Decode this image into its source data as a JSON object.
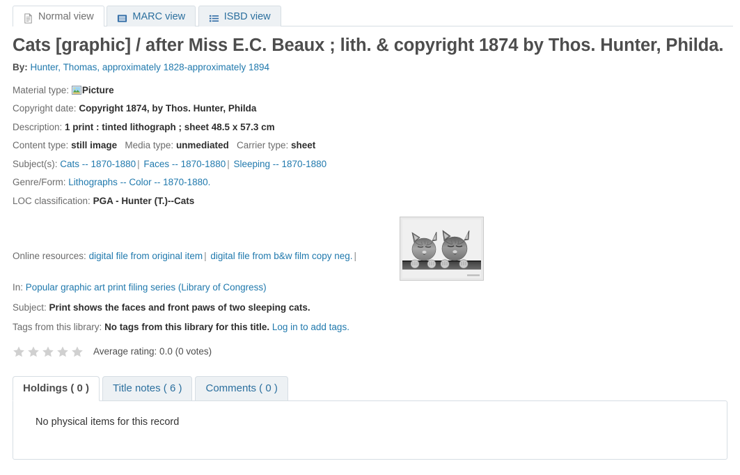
{
  "view_tabs": [
    {
      "label": "Normal view",
      "icon": "document-icon",
      "active": true
    },
    {
      "label": "MARC view",
      "icon": "table-list-icon",
      "active": false
    },
    {
      "label": "ISBD view",
      "icon": "list-icon",
      "active": false
    }
  ],
  "record": {
    "title": "Cats [graphic] / after Miss E.C. Beaux ; lith. & copyright 1874 by Thos. Hunter, Philda.",
    "by_label": "By:",
    "author": "Hunter, Thomas, approximately 1828-approximately 1894",
    "material_type_label": "Material type:",
    "material_type_value": "Picture",
    "material_type_icon": "picture-icon",
    "copyright_date_label": "Copyright date:",
    "copyright_date_value": "Copyright 1874, by Thos. Hunter, Philda",
    "description_label": "Description:",
    "description_value": "1 print : tinted lithograph ; sheet 48.5 x 57.3 cm",
    "content_type_label": "Content type:",
    "content_type_value": "still image",
    "media_type_label": "Media type:",
    "media_type_value": "unmediated",
    "carrier_type_label": "Carrier type:",
    "carrier_type_value": "sheet",
    "subjects_label": "Subject(s):",
    "subjects": [
      "Cats -- 1870-1880",
      "Faces -- 1870-1880",
      "Sleeping -- 1870-1880"
    ],
    "subject_separator": "|",
    "genre_label": "Genre/Form:",
    "genre_value": "Lithographs -- Color -- 1870-1880.",
    "loc_label": "LOC classification:",
    "loc_value": "PGA - Hunter (T.)--Cats",
    "online_resources_label": "Online resources:",
    "online_resources": [
      "digital file from original item",
      "digital file from b&w film copy neg."
    ],
    "resource_separator": "|",
    "in_label": "In:",
    "in_value": "Popular graphic art print filing series (Library of Congress)",
    "subject_note_label": "Subject:",
    "subject_note_value": "Print shows the faces and front paws of two sleeping cats.",
    "tags_label": "Tags from this library:",
    "tags_value": "No tags from this library for this title.",
    "tags_link": "Log in to add tags.",
    "rating_text": "Average rating: 0.0 (0 votes)",
    "star_count": 5,
    "thumbnail_alt": "Two sleeping cats peering over a ledge"
  },
  "holdings": {
    "tabs": [
      {
        "label": "Holdings ( 0 )",
        "active": true
      },
      {
        "label": "Title notes ( 6 )",
        "active": false
      },
      {
        "label": "Comments ( 0 )",
        "active": false
      }
    ],
    "empty_message": "No physical items for this record"
  },
  "colors": {
    "link": "#2079ad",
    "tab_inactive_bg": "#edf1f4",
    "border": "#d6dde3",
    "star_gray": "#d0d0d0"
  }
}
